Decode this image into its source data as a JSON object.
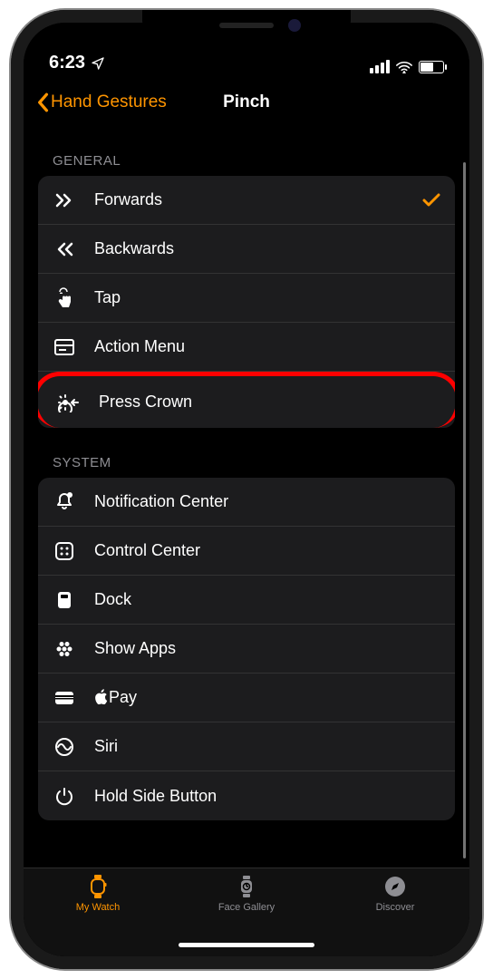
{
  "status": {
    "time": "6:23"
  },
  "nav": {
    "back_label": "Hand Gestures",
    "title": "Pinch"
  },
  "sections": {
    "general": {
      "header": "GENERAL",
      "items": [
        {
          "label": "Forwards",
          "checked": true
        },
        {
          "label": "Backwards"
        },
        {
          "label": "Tap"
        },
        {
          "label": "Action Menu"
        },
        {
          "label": "Press Crown",
          "highlight": true
        }
      ]
    },
    "system": {
      "header": "SYSTEM",
      "items": [
        {
          "label": "Notification Center"
        },
        {
          "label": "Control Center"
        },
        {
          "label": "Dock"
        },
        {
          "label": "Show Apps"
        },
        {
          "label": "Pay"
        },
        {
          "label": "Siri"
        },
        {
          "label": "Hold Side Button"
        }
      ]
    }
  },
  "tabs": {
    "my_watch": "My Watch",
    "face_gallery": "Face Gallery",
    "discover": "Discover"
  },
  "colors": {
    "accent": "#ff9500"
  }
}
